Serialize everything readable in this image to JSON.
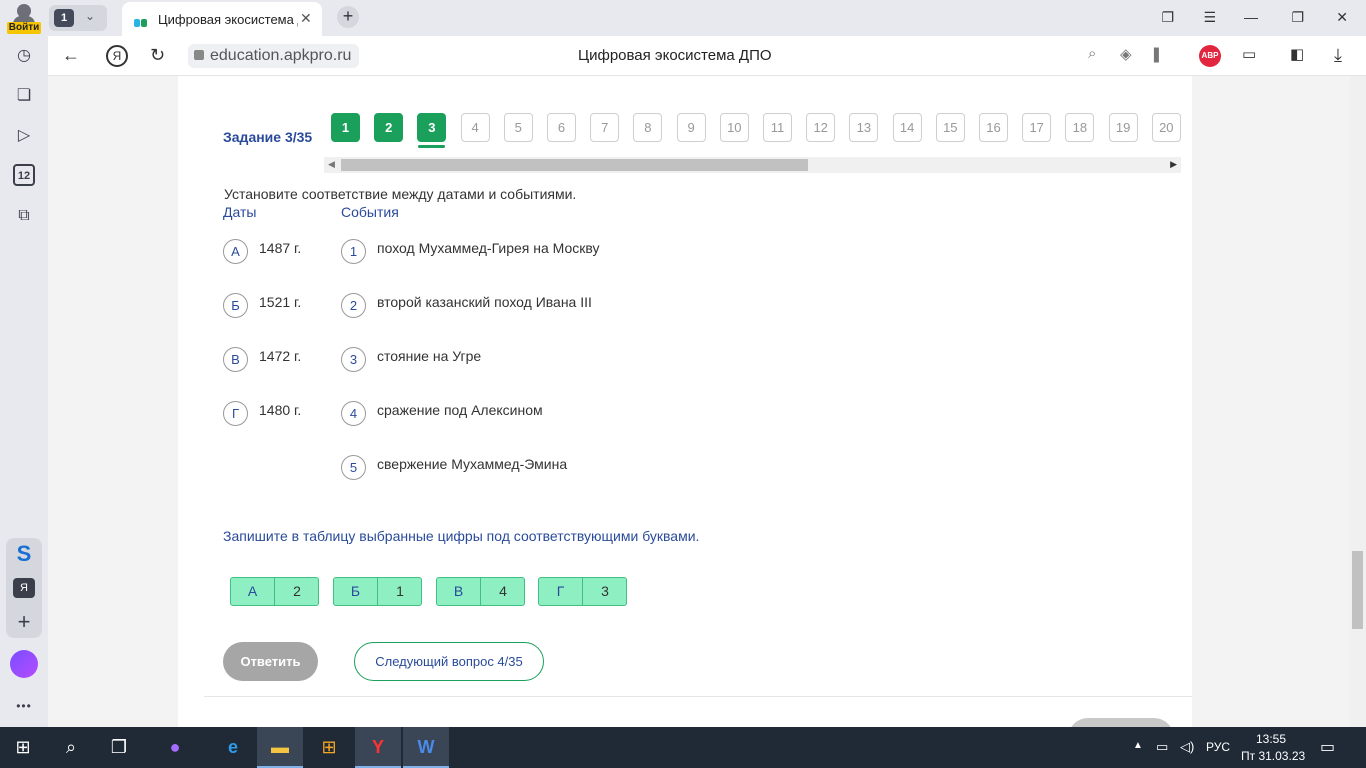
{
  "browser": {
    "login_label": "Войти",
    "tabs_count": "1",
    "tab_title": "Цифровая экосистема ДПО",
    "url": "education.apkpro.ru",
    "page_title": "Цифровая экосистема ДПО",
    "adblock_label": "ABP"
  },
  "sidebar": {
    "calendar_badge": "12",
    "yandex_label": "Я"
  },
  "quiz": {
    "task_label": "Задание 3/35",
    "questions": [
      {
        "label": "1",
        "state": "done"
      },
      {
        "label": "2",
        "state": "done"
      },
      {
        "label": "3",
        "state": "current"
      },
      {
        "label": "4",
        "state": "todo"
      },
      {
        "label": "5",
        "state": "todo"
      },
      {
        "label": "6",
        "state": "todo"
      },
      {
        "label": "7",
        "state": "todo"
      },
      {
        "label": "8",
        "state": "todo"
      },
      {
        "label": "9",
        "state": "todo"
      },
      {
        "label": "10",
        "state": "todo"
      },
      {
        "label": "11",
        "state": "todo"
      },
      {
        "label": "12",
        "state": "todo"
      },
      {
        "label": "13",
        "state": "todo"
      },
      {
        "label": "14",
        "state": "todo"
      },
      {
        "label": "15",
        "state": "todo"
      },
      {
        "label": "16",
        "state": "todo"
      },
      {
        "label": "17",
        "state": "todo"
      },
      {
        "label": "18",
        "state": "todo"
      },
      {
        "label": "19",
        "state": "todo"
      },
      {
        "label": "20",
        "state": "todo"
      }
    ],
    "instruction": "Установите соответствие между датами и событиями.",
    "dates_header": "Даты",
    "events_header": "События",
    "dates": [
      {
        "key": "А",
        "text": "1487 г."
      },
      {
        "key": "Б",
        "text": "1521 г."
      },
      {
        "key": "В",
        "text": "1472 г."
      },
      {
        "key": "Г",
        "text": "1480 г."
      }
    ],
    "events": [
      {
        "key": "1",
        "text": "поход Мухаммед-Гирея на Москву"
      },
      {
        "key": "2",
        "text": "второй казанский поход Ивана III"
      },
      {
        "key": "3",
        "text": "стояние на Угре"
      },
      {
        "key": "4",
        "text": "сражение под Алексином"
      },
      {
        "key": "5",
        "text": "свержение Мухаммед-Эмина"
      }
    ],
    "write_instruction": "Запишите в таблицу выбранные цифры под соответствующими буквами.",
    "answers": [
      {
        "letter": "А",
        "digit": "2"
      },
      {
        "letter": "Б",
        "digit": "1"
      },
      {
        "letter": "В",
        "digit": "4"
      },
      {
        "letter": "Г",
        "digit": "3"
      }
    ],
    "answer_button": "Ответить",
    "next_button": "Следующий вопрос 4/35"
  },
  "taskbar": {
    "lang": "РУС",
    "time": "13:55",
    "date": "Пт 31.03.23"
  }
}
